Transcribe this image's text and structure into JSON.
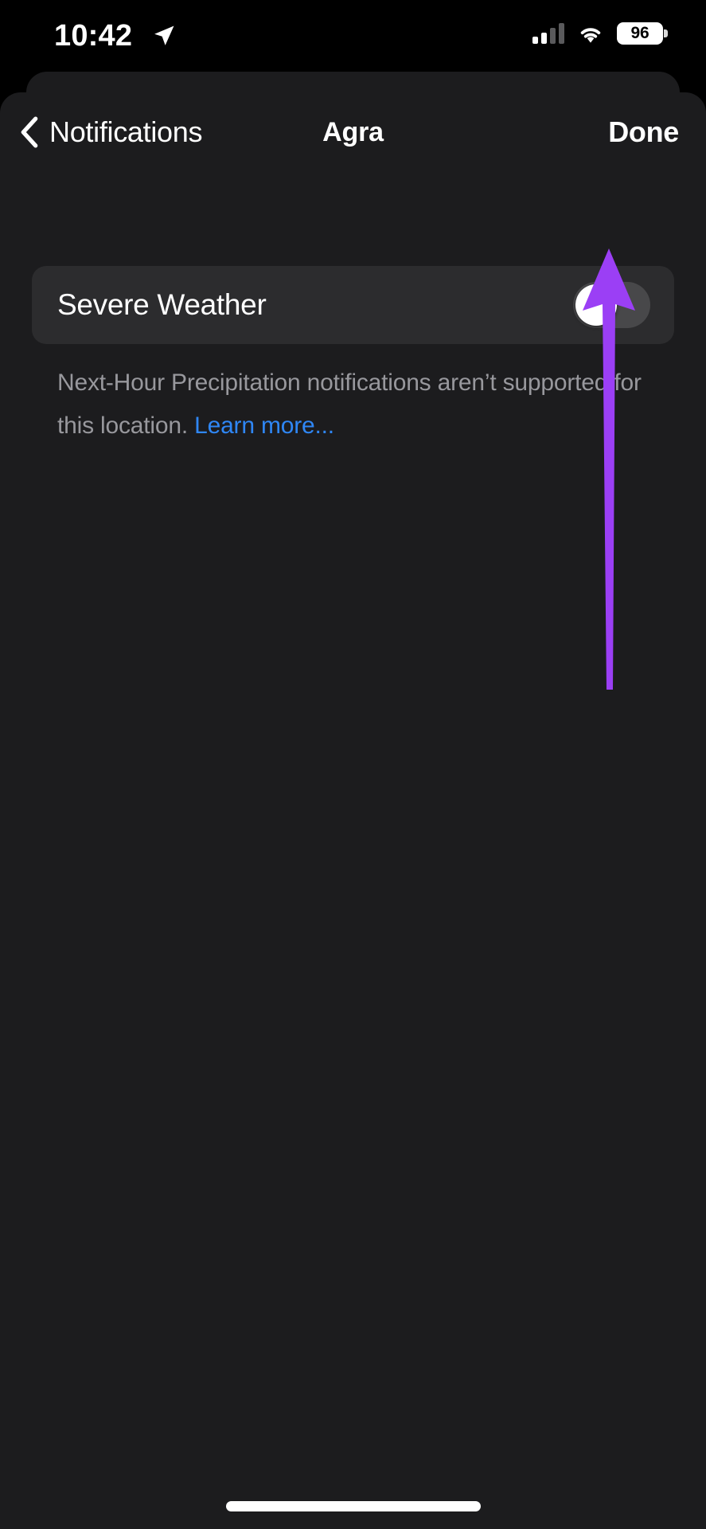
{
  "status_bar": {
    "time": "10:42",
    "location_icon": "location-arrow-icon",
    "cellular_icon": "cellular-signal-icon",
    "cellular_bars_active": 2,
    "cellular_bars_total": 4,
    "wifi_icon": "wifi-icon",
    "battery_percent": "96",
    "battery_icon": "battery-icon"
  },
  "nav": {
    "back_icon": "chevron-left-icon",
    "back_label": "Notifications",
    "title": "Agra",
    "done_label": "Done"
  },
  "settings": {
    "severe_weather": {
      "label": "Severe Weather",
      "toggle_state": "off",
      "toggle_track_color": "#48484a",
      "toggle_knob_color": "#ffffff"
    },
    "footnote": {
      "text": "Next-Hour Precipitation notifications aren’t supported for this location. ",
      "link_label": "Learn more...",
      "link_color": "#2f87f6",
      "text_color": "#98989d"
    }
  },
  "annotation": {
    "arrow_icon": "arrow-up-callout-icon",
    "arrow_color": "#9b3ff5",
    "points_at": "severe-weather-toggle"
  },
  "system": {
    "home_indicator": "home-indicator",
    "background_color": "#1c1c1e",
    "card_color": "#2c2c2e"
  }
}
